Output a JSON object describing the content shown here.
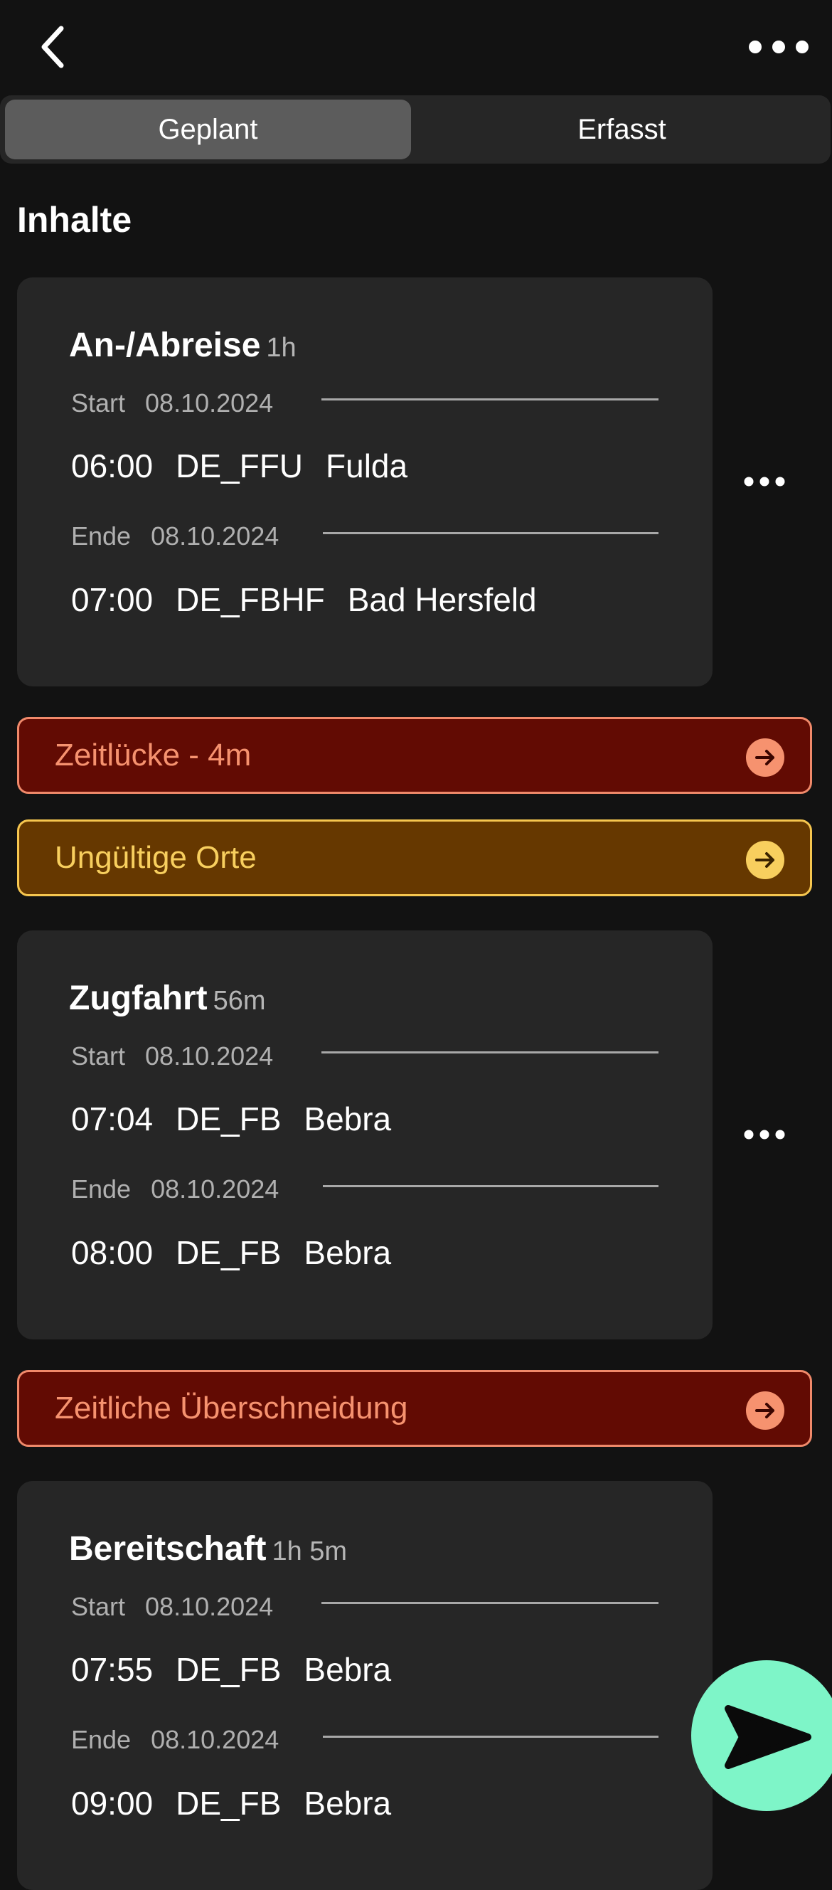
{
  "header": {
    "tabs": [
      {
        "label": "Geplant",
        "active": true
      },
      {
        "label": "Erfasst",
        "active": false
      }
    ]
  },
  "section_title": "Inhalte",
  "entries": [
    {
      "title": "An-/Abreise",
      "duration": "1h",
      "start": {
        "label": "Start",
        "date": "08.10.2024",
        "time": "06:00",
        "code": "DE_FFU",
        "place": "Fulda"
      },
      "end": {
        "label": "Ende",
        "date": "08.10.2024",
        "time": "07:00",
        "code": "DE_FBHF",
        "place": "Bad Hersfeld"
      }
    },
    {
      "title": "Zugfahrt",
      "duration": "56m",
      "start": {
        "label": "Start",
        "date": "08.10.2024",
        "time": "07:04",
        "code": "DE_FB",
        "place": "Bebra"
      },
      "end": {
        "label": "Ende",
        "date": "08.10.2024",
        "time": "08:00",
        "code": "DE_FB",
        "place": "Bebra"
      }
    },
    {
      "title": "Bereitschaft",
      "duration": "1h 5m",
      "start": {
        "label": "Start",
        "date": "08.10.2024",
        "time": "07:55",
        "code": "DE_FB",
        "place": "Bebra"
      },
      "end": {
        "label": "Ende",
        "date": "08.10.2024",
        "time": "09:00",
        "code": "DE_FB",
        "place": "Bebra"
      }
    }
  ],
  "alerts": [
    {
      "text": "Zeitlücke - 4m",
      "severity": "error"
    },
    {
      "text": "Ungültige Orte",
      "severity": "warning"
    },
    {
      "text": "Zeitliche Überschneidung",
      "severity": "error"
    }
  ],
  "colors": {
    "background": "#121212",
    "card": "#262626",
    "error_fill": "#620b03",
    "error_accent": "#f6926f",
    "warning_fill": "#663800",
    "warning_accent": "#f8cf5e",
    "fab": "#7ef5c8"
  },
  "icons": {
    "back": "chevron-left-icon",
    "more": "more-horizontal-icon",
    "alert_arrow": "arrow-right-circle-icon",
    "send": "send-icon"
  }
}
